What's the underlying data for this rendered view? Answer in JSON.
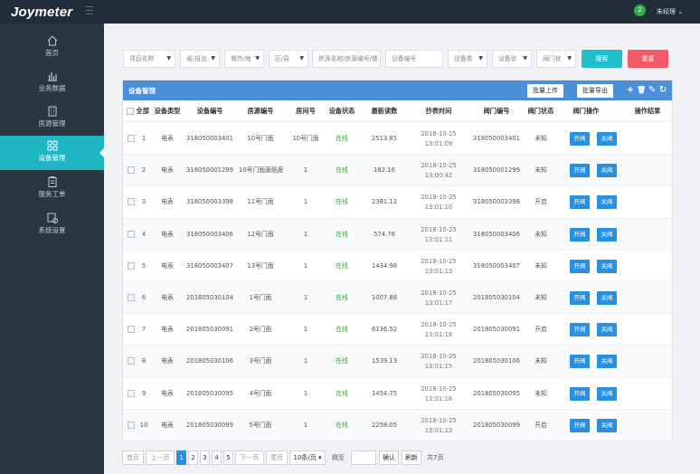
{
  "app": {
    "logo_main": "Joymeter",
    "user_badge": "2",
    "user_name": "朱经理 ⌄"
  },
  "sidebar": {
    "items": [
      {
        "label": "首页",
        "icon": "home-icon"
      },
      {
        "label": "业务数据",
        "icon": "bar-chart-icon"
      },
      {
        "label": "房源管理",
        "icon": "building-icon"
      },
      {
        "label": "设备管理",
        "icon": "grid-icon",
        "active": true
      },
      {
        "label": "服务工单",
        "icon": "clipboard-icon"
      },
      {
        "label": "系统设置",
        "icon": "settings-icon"
      }
    ]
  },
  "filters": {
    "project_name": "项目名称",
    "province": "省/自治",
    "city": "城市/地",
    "district": "区/县",
    "house_search": "房源名称/房源编号/楼",
    "device_no": "设备编号",
    "device_type": "设备类",
    "device_status": "设备状",
    "valve_status": "阀门状",
    "search_label": "搜索",
    "reset_label": "重置"
  },
  "panel": {
    "title": "设备管理",
    "upload_label": "批量上传",
    "export_label": "批量导出"
  },
  "table": {
    "headers": {
      "select_all": "全部",
      "device_type": "设备类型",
      "device_no": "设备编号",
      "house_no": "房源编号",
      "room_no": "房间号",
      "device_status": "设备状态",
      "latest_reading": "最新读数",
      "read_time": "抄表时间",
      "valve_no": "阀门编号",
      "valve_status": "阀门状态",
      "valve_ops": "阀门操作",
      "op_result": "操作结果"
    },
    "open_label": "开阀",
    "close_label": "关阀",
    "rows": [
      {
        "no": "1",
        "type": "电表",
        "device_no": "318050003401",
        "house": "10号门面",
        "room": "10号门面",
        "status": "在线",
        "reading": "2513.85",
        "date": "2018-10-25",
        "time": "13:01:09",
        "valve_no": "318050003401",
        "valve_status": "未知"
      },
      {
        "no": "2",
        "type": "电表",
        "device_no": "318050001299",
        "house": "10号门面唐纸疲",
        "room": "1",
        "status": "在线",
        "reading": "182.16",
        "date": "2018-10-25",
        "time": "13:00:42",
        "valve_no": "318050001299",
        "valve_status": "未知"
      },
      {
        "no": "3",
        "type": "电表",
        "device_no": "318050003398",
        "house": "11号门面",
        "room": "1",
        "status": "在线",
        "reading": "2381.12",
        "date": "2018-10-25",
        "time": "13:01:10",
        "valve_no": "318050003398",
        "valve_status": "开启"
      },
      {
        "no": "4",
        "type": "电表",
        "device_no": "318050003406",
        "house": "12号门面",
        "room": "1",
        "status": "在线",
        "reading": "574.76",
        "date": "2018-10-25",
        "time": "13:01:11",
        "valve_no": "318050003406",
        "valve_status": "未知"
      },
      {
        "no": "5",
        "type": "电表",
        "device_no": "318050003407",
        "house": "13号门面",
        "room": "1",
        "status": "在线",
        "reading": "1434.98",
        "date": "2018-10-25",
        "time": "13:01:13",
        "valve_no": "318050003407",
        "valve_status": "未知"
      },
      {
        "no": "6",
        "type": "电表",
        "device_no": "201805030104",
        "house": "1号门面",
        "room": "1",
        "status": "在线",
        "reading": "1007.88",
        "date": "2018-10-25",
        "time": "13:01:17",
        "valve_no": "201805030104",
        "valve_status": "未知"
      },
      {
        "no": "7",
        "type": "电表",
        "device_no": "201805030091",
        "house": "2号门面",
        "room": "1",
        "status": "在线",
        "reading": "6136.52",
        "date": "2018-10-25",
        "time": "13:01:18",
        "valve_no": "201805030091",
        "valve_status": "开启"
      },
      {
        "no": "8",
        "type": "电表",
        "device_no": "201805030106",
        "house": "3号门面",
        "room": "1",
        "status": "在线",
        "reading": "1539.13",
        "date": "2018-10-25",
        "time": "13:01:15",
        "valve_no": "201805030106",
        "valve_status": "未知"
      },
      {
        "no": "9",
        "type": "电表",
        "device_no": "201805030095",
        "house": "4号门面",
        "room": "1",
        "status": "在线",
        "reading": "1454.75",
        "date": "2018-10-25",
        "time": "13:01:16",
        "valve_no": "201805030095",
        "valve_status": "未知"
      },
      {
        "no": "10",
        "type": "电表",
        "device_no": "201805030099",
        "house": "5号门面",
        "room": "1",
        "status": "在线",
        "reading": "2258.05",
        "date": "2018-10-25",
        "time": "13:01:13",
        "valve_no": "201805030099",
        "valve_status": "开启"
      }
    ]
  },
  "pager": {
    "first": "首页",
    "prev": "上一页",
    "pages": [
      "1",
      "2",
      "3",
      "4",
      "5"
    ],
    "current": "1",
    "next": "下一页",
    "last": "尾页",
    "page_size": "10条/页",
    "jump_label": "跳至",
    "confirm": "确认",
    "refresh": "刷新",
    "total": "共7页"
  },
  "colors": {
    "topbar": "#222d3a",
    "sidebar": "#2b3643",
    "active_nav": "#1fb5c3",
    "panel_header": "#4a8fd8",
    "search_button": "#1fc0cc",
    "reset_button": "#f35a68",
    "op_button": "#2890e0",
    "online_text": "#2ca830"
  }
}
